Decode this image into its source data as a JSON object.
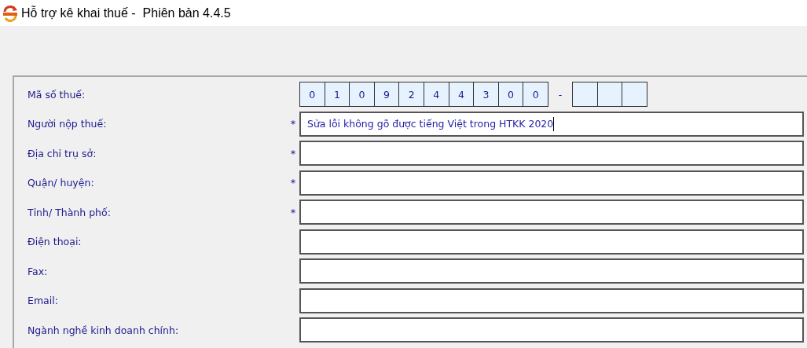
{
  "window": {
    "title": "Hỗ trợ kê khai thuế -  Phiên bản 4.4.5"
  },
  "fields": [
    {
      "kind": "tax_code",
      "label": "Mã số thuế:",
      "digits": [
        "0",
        "1",
        "0",
        "9",
        "2",
        "4",
        "4",
        "3",
        "0",
        "0"
      ],
      "separator": "-",
      "branch_cells": [
        {
          "value_shown": false
        },
        {
          "value_shown": false
        },
        {
          "value_shown": false
        }
      ]
    },
    {
      "kind": "text",
      "label": "Người nộp thuế:",
      "marker": "*",
      "value": "Sửa lỗi không gõ được tiếng Việt trong HTKK 2020",
      "focused": true
    },
    {
      "kind": "text",
      "label": "Địa chỉ trụ sở:",
      "marker": "*",
      "focused": false
    },
    {
      "kind": "text",
      "label": "Quận/ huyện:",
      "marker": "*",
      "focused": false
    },
    {
      "kind": "text",
      "label": "Tỉnh/ Thành phố:",
      "marker": "*",
      "focused": false
    },
    {
      "kind": "text",
      "label": "Điện thoại:",
      "focused": false
    },
    {
      "kind": "text",
      "label": "Fax:",
      "focused": false
    },
    {
      "kind": "text",
      "label": "Email:",
      "focused": false
    },
    {
      "kind": "text",
      "label": "Ngành nghề kinh doanh chính:",
      "focused": false
    }
  ]
}
